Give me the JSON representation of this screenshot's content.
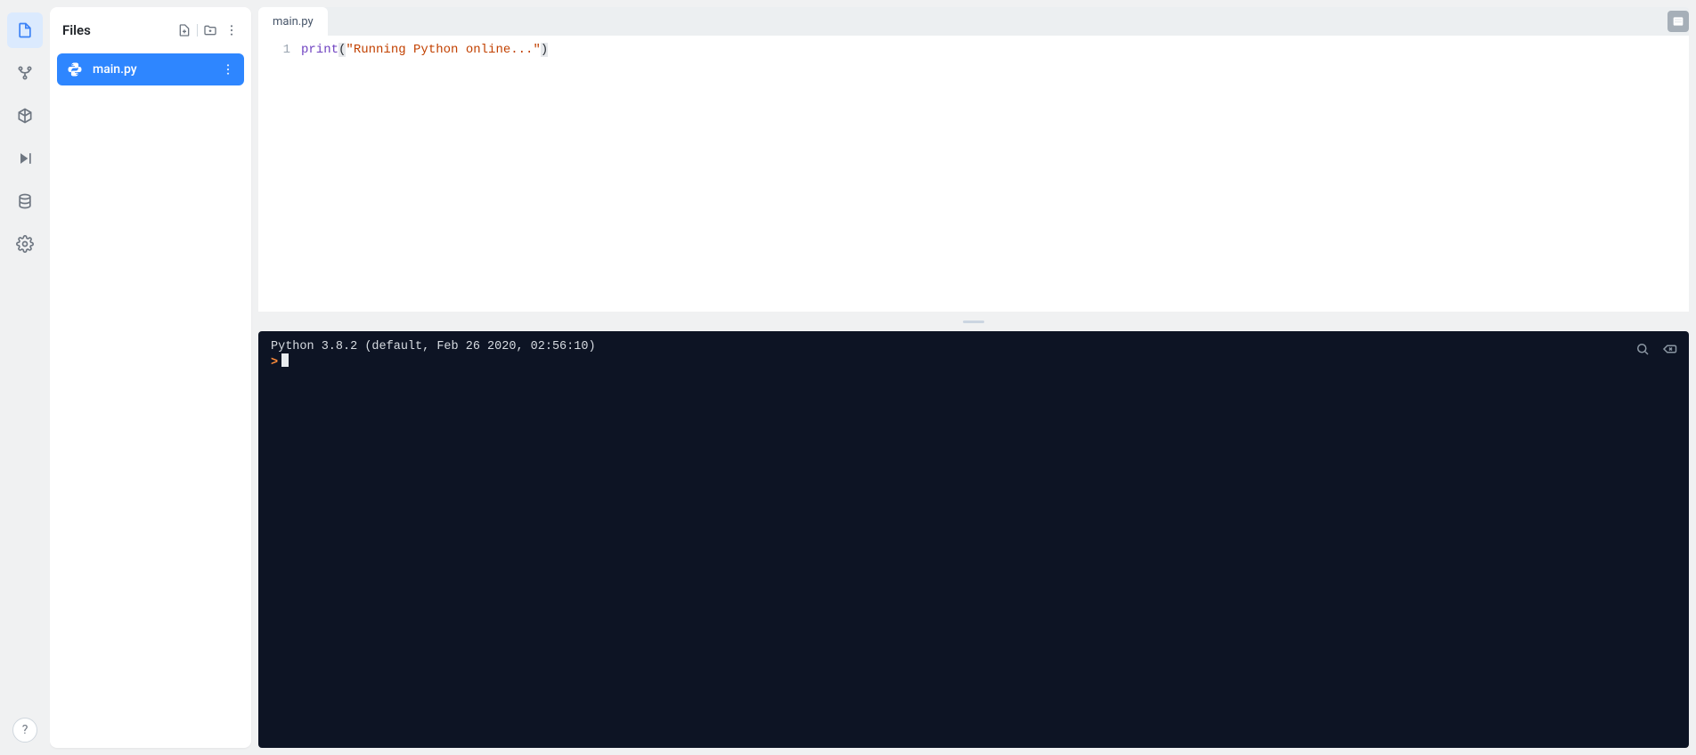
{
  "sidebar": {
    "panel_title": "Files"
  },
  "files": {
    "items": [
      {
        "name": "main.py"
      }
    ]
  },
  "tabs": {
    "items": [
      {
        "label": "main.py"
      }
    ]
  },
  "editor": {
    "line_number": "1",
    "token_call": "print",
    "token_paren_open": "(",
    "token_string": "\"Running Python online...\"",
    "token_paren_close": ")"
  },
  "console": {
    "banner": "Python 3.8.2 (default, Feb 26 2020, 02:56:10)",
    "prompt": ">"
  }
}
